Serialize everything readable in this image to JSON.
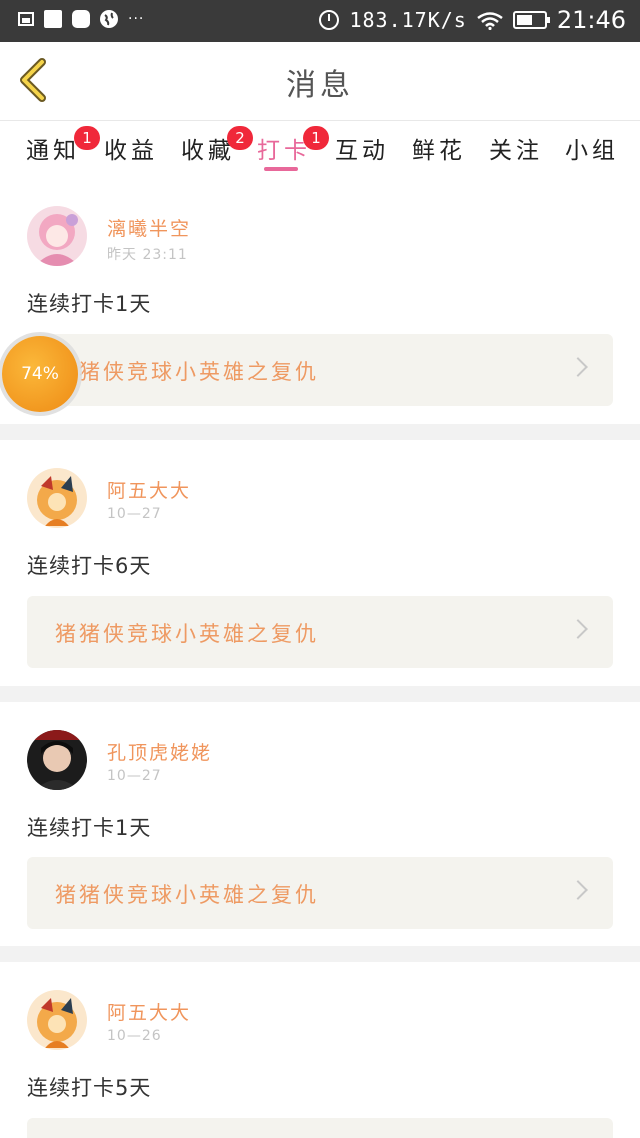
{
  "status_bar": {
    "network_speed": "183.17K/s",
    "time": "21:46",
    "left_icons": [
      "image-icon",
      "square-icon",
      "rounded-square-icon",
      "globe-icon"
    ],
    "more": "···",
    "right_icons": [
      "alarm-icon",
      "wifi-icon",
      "battery-icon"
    ]
  },
  "header": {
    "title": "消息",
    "back_icon": "chevron-left-icon"
  },
  "tabs": [
    {
      "label": "通知",
      "badge": "1"
    },
    {
      "label": "收益",
      "badge": ""
    },
    {
      "label": "收藏",
      "badge": "2"
    },
    {
      "label": "打卡",
      "badge": "1",
      "active": true
    },
    {
      "label": "互动",
      "badge": ""
    },
    {
      "label": "鲜花",
      "badge": ""
    },
    {
      "label": "关注",
      "badge": ""
    },
    {
      "label": "小组",
      "badge": ""
    }
  ],
  "messages": [
    {
      "user": "漓曦半空",
      "time": "昨天 23:11",
      "text": "连续打卡1天",
      "link": "猪猪侠竞球小英雄之复仇"
    },
    {
      "user": "阿五大大",
      "time": "10—27",
      "text": "连续打卡6天",
      "link": "猪猪侠竞球小英雄之复仇"
    },
    {
      "user": "孔顶虎姥姥",
      "time": "10—27",
      "text": "连续打卡1天",
      "link": "猪猪侠竞球小英雄之复仇"
    },
    {
      "user": "阿五大大",
      "time": "10—26",
      "text": "连续打卡5天",
      "link": ""
    }
  ],
  "floating_bubble": {
    "label": "74%",
    "value": 74
  },
  "colors": {
    "accent": "#e8689a",
    "username": "#f0955c",
    "badge": "#f0283a",
    "link_bg": "#f4f3ee"
  }
}
